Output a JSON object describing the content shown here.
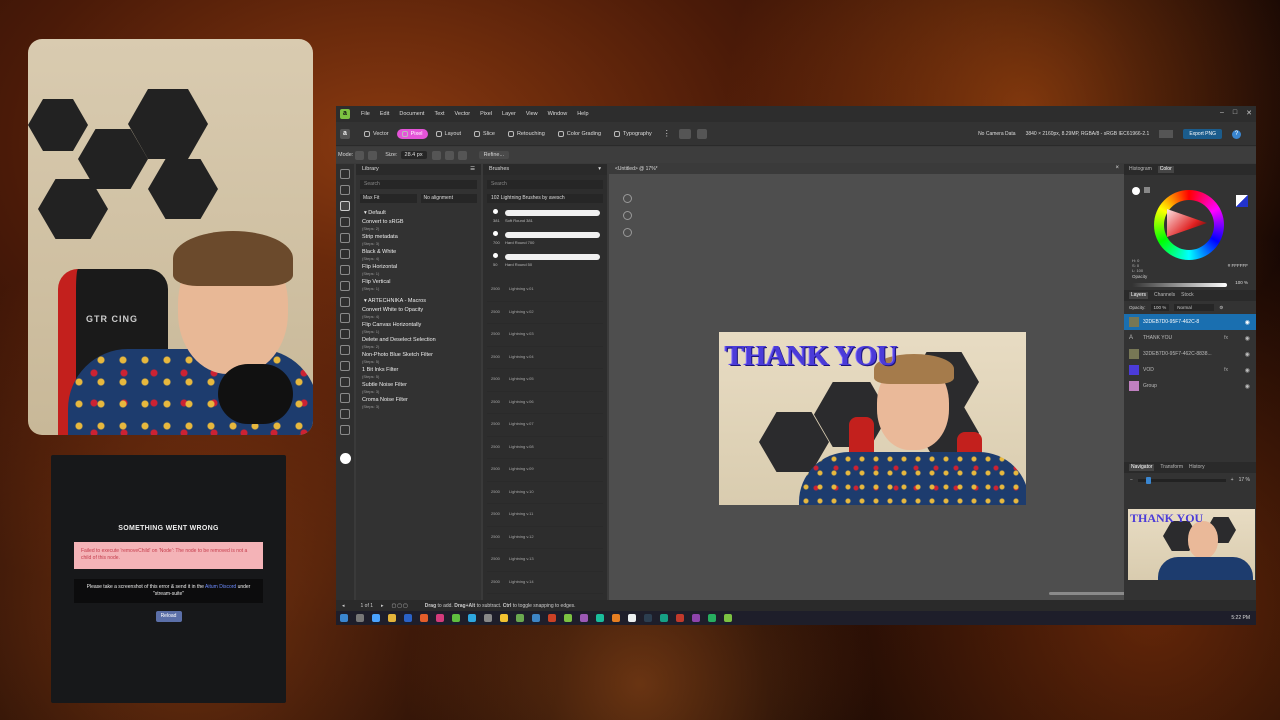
{
  "webcam": {
    "chair_brand": "GTR CING"
  },
  "error_panel": {
    "title": "SOMETHING WENT WRONG",
    "message": "Failed to execute 'removeChild' on 'Node': The node to be removed is not a child of this node.",
    "note_prefix": "Please take a screenshot of this error & send it in the",
    "note_link": "Aitum Discord",
    "note_suffix": "under \"stream-suite\"",
    "reload_label": "Reload"
  },
  "app": {
    "menu": [
      "File",
      "Edit",
      "Document",
      "Text",
      "Vector",
      "Pixel",
      "Layer",
      "View",
      "Window",
      "Help"
    ],
    "personas": [
      "Vector",
      "Pixel",
      "Layout",
      "Slice",
      "Retouching",
      "Color Grading",
      "Typography"
    ],
    "active_persona": "Pixel",
    "toolbar_info": {
      "camera": "No Camera Data",
      "doc_info": "3840 × 2160px, 8.29MP, RGBA/8 - sRGB IEC61966-2.1",
      "export": "Export PNG"
    },
    "context": {
      "mode_label": "Mode:",
      "size_label": "Size:",
      "size_value": "28.4 px",
      "refine_label": "Refine..."
    },
    "library": {
      "title": "Library",
      "search_placeholder": "Search",
      "fit_option": "Max Fit",
      "align_option": "No alignment",
      "groups": [
        {
          "name": "Default",
          "items": [
            {
              "name": "Convert to sRGB",
              "steps": "(Steps: 2)"
            },
            {
              "name": "Strip metadata",
              "steps": "(Steps: 3)"
            },
            {
              "name": "Black & White",
              "steps": "(Steps: 4)"
            },
            {
              "name": "Flip Horizontal",
              "steps": "(Steps: 1)"
            },
            {
              "name": "Flip Vertical",
              "steps": "(Steps: 1)"
            }
          ]
        },
        {
          "name": "ARTECHNIKA - Macros",
          "items": [
            {
              "name": "Convert White to Opacity",
              "steps": "(Steps: 4)"
            },
            {
              "name": "Flip Canvas Horizontally",
              "steps": "(Steps: 1)"
            },
            {
              "name": "Delete and Deselect Selection",
              "steps": "(Steps: 2)"
            },
            {
              "name": "Non-Photo Blue Sketch Filter",
              "steps": "(Steps: 5)"
            },
            {
              "name": "1 Bit Inks Filter",
              "steps": "(Steps: 5)"
            },
            {
              "name": "Subtle Noise Filter",
              "steps": "(Steps: 3)"
            },
            {
              "name": "Croma Noise Filter",
              "steps": "(Steps: 3)"
            }
          ]
        }
      ]
    },
    "brushes": {
      "title": "Brushes",
      "search_placeholder": "Search",
      "category": "102 Lightning Brushes by avesch",
      "round": [
        {
          "num": "381",
          "name": "Soft Round 381"
        },
        {
          "num": "700",
          "name": "Hard Round 700"
        },
        {
          "num": "50",
          "name": "Hard Round 50"
        }
      ],
      "lightning": [
        {
          "num": "2500",
          "name": "Lightning v.01"
        },
        {
          "num": "2500",
          "name": "Lightning v.02"
        },
        {
          "num": "2500",
          "name": "Lightning v.03"
        },
        {
          "num": "2500",
          "name": "Lightning v.04"
        },
        {
          "num": "2500",
          "name": "Lightning v.05"
        },
        {
          "num": "2500",
          "name": "Lightning v.06"
        },
        {
          "num": "2500",
          "name": "Lightning v.07"
        },
        {
          "num": "2500",
          "name": "Lightning v.08"
        },
        {
          "num": "2500",
          "name": "Lightning v.09"
        },
        {
          "num": "2500",
          "name": "Lightning v.10"
        },
        {
          "num": "2500",
          "name": "Lightning v.11"
        },
        {
          "num": "2500",
          "name": "Lightning v.12"
        },
        {
          "num": "2500",
          "name": "Lightning v.13"
        },
        {
          "num": "2500",
          "name": "Lightning v.14"
        }
      ]
    },
    "document": {
      "tab": "<Untitled> @ 17%*",
      "headline": "THANK YOU"
    },
    "color_panel": {
      "tabs": [
        "Histogram",
        "Color"
      ],
      "active_tab": "Color",
      "hex": "# FFFFFF",
      "opacity_label": "Opacity",
      "opacity_value": "100 %",
      "hsl": [
        "H: 0",
        "S: 0",
        "L: 100"
      ]
    },
    "layers_panel": {
      "tabs": [
        "Layers",
        "Channels",
        "Stock"
      ],
      "active_tab": "Layers",
      "opacity_label": "Opacity:",
      "opacity_value": "100 %",
      "blend_mode": "Normal",
      "layers": [
        {
          "name": "32DEB7D0-95F7-462C-8",
          "selected": true,
          "fx": false
        },
        {
          "name": "THANK YOU",
          "selected": false,
          "fx": true
        },
        {
          "name": "32DEB7D0-95F7-462C-8838...",
          "selected": false,
          "fx": false
        },
        {
          "name": "VOD",
          "selected": false,
          "fx": true
        },
        {
          "name": "Group",
          "selected": false,
          "fx": false
        }
      ]
    },
    "navigator": {
      "tabs": [
        "Navigator",
        "Transform",
        "History"
      ],
      "active_tab": "Navigator",
      "zoom": "17 %",
      "thumb_title": "THANK YOU"
    },
    "status": {
      "pages": "1 of 1",
      "hint_bold1": "Drag",
      "hint1": " to add. ",
      "hint_bold2": "Drag+Alt",
      "hint2": " to subtract. ",
      "hint_bold3": "Ctrl",
      "hint3": " to toggle snapping to edges."
    },
    "taskbar_time": "5:22 PM"
  },
  "colors": {
    "accent_persona": "#e454d8",
    "layer_selected": "#1a6fb0",
    "headline": "#4b3bd8",
    "error_bg": "#f4b3b7"
  }
}
